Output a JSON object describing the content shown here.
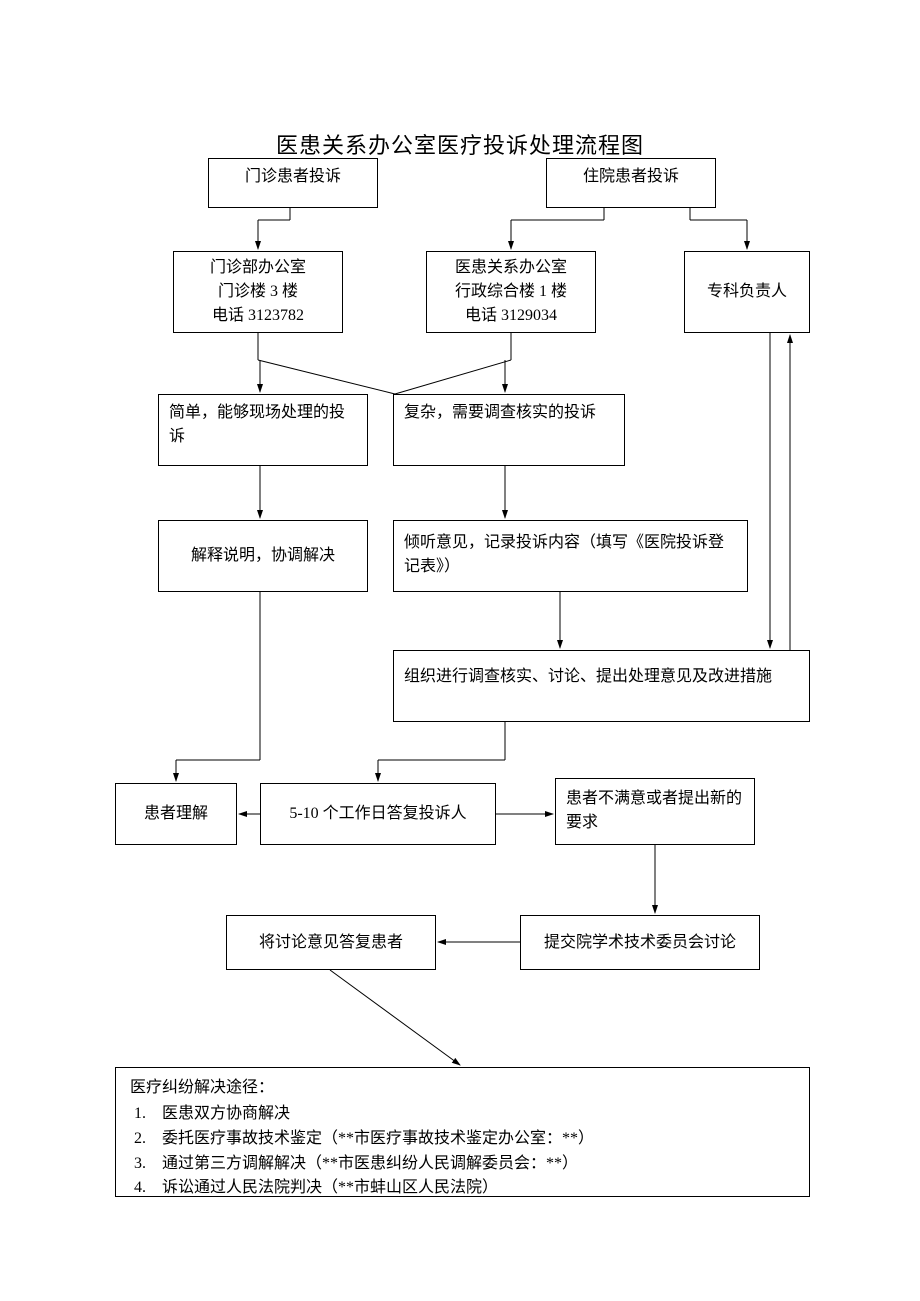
{
  "title": "医患关系办公室医疗投诉处理流程图",
  "nodes": {
    "outpatient_complaint": "门诊患者投诉",
    "inpatient_complaint": "住院患者投诉",
    "outpatient_office": {
      "l1": "门诊部办公室",
      "l2": "门诊楼 3 楼",
      "l3": "电话 3123782"
    },
    "relations_office": {
      "l1": "医患关系办公室",
      "l2": "行政综合楼 1 楼",
      "l3": "电话 3129034"
    },
    "specialist": "专科负责人",
    "simple": "简单，能够现场处理的投诉",
    "complex": "复杂，需要调查核实的投诉",
    "explain": "解释说明，协调解决",
    "listen": "倾听意见，记录投诉内容（填写《医院投诉登记表》）",
    "investigate": "组织进行调查核实、讨论、提出处理意见及改进措施",
    "understood": "患者理解",
    "reply": "5-10 个工作日答复投诉人",
    "unsatisfied": "患者不满意或者提出新的要求",
    "feedback": "将讨论意见答复患者",
    "committee": "提交院学术技术委员会讨论",
    "resolution": {
      "heading": "医疗纠纷解决途径：",
      "items": [
        "1.　医患双方协商解决",
        "2.　委托医疗事故技术鉴定（**市医疗事故技术鉴定办公室：**）",
        "3.　通过第三方调解解决（**市医患纠纷人民调解委员会：**）",
        "4.　诉讼通过人民法院判决（**市蚌山区人民法院）"
      ]
    }
  }
}
